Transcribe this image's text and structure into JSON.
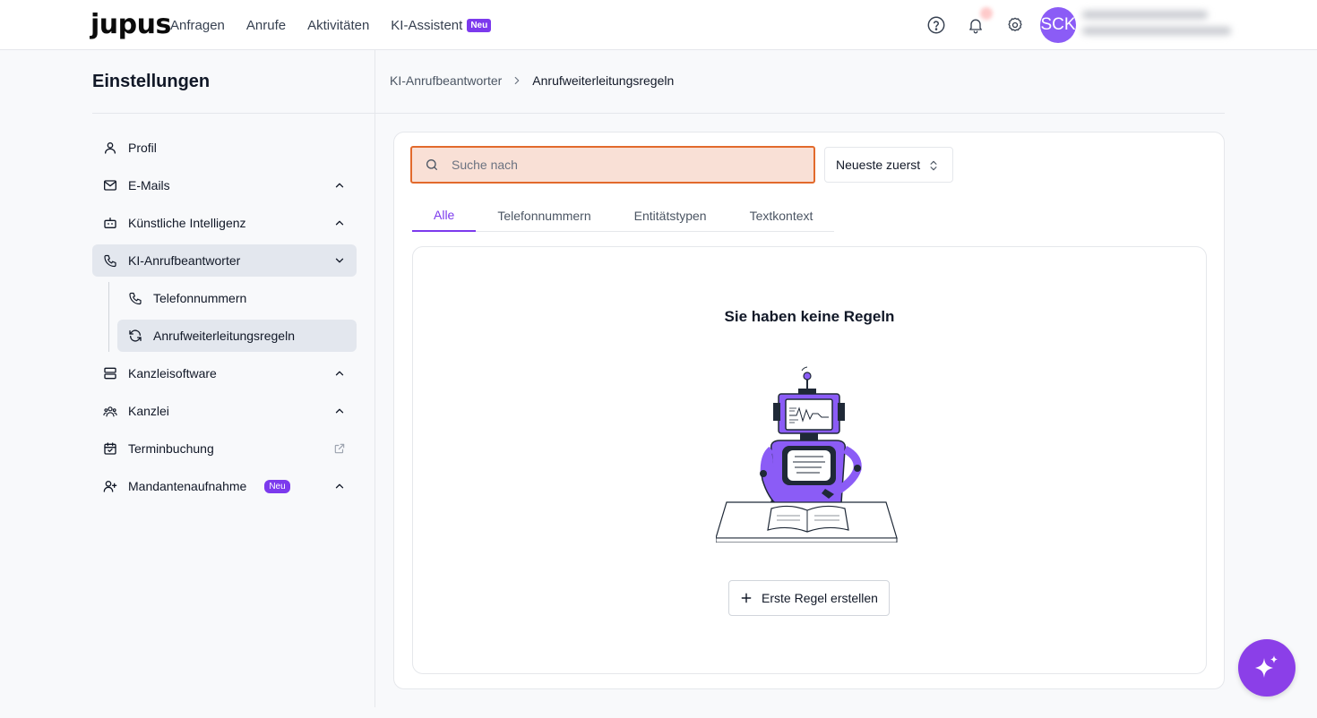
{
  "header": {
    "logo": "jupus",
    "nav": [
      {
        "label": "Anfragen"
      },
      {
        "label": "Anrufe"
      },
      {
        "label": "Aktivitäten"
      },
      {
        "label": "KI-Assistent",
        "badge": "Neu"
      }
    ],
    "avatar_initials": "SCK",
    "icons": [
      "help-icon",
      "bell-icon",
      "gear-icon"
    ]
  },
  "sidebar": {
    "title": "Einstellungen",
    "items": [
      {
        "label": "Profil",
        "icon": "user-icon"
      },
      {
        "label": "E-Mails",
        "icon": "mail-icon",
        "chevron": "up"
      },
      {
        "label": "Künstliche Intelligenz",
        "icon": "robot-icon",
        "chevron": "up"
      },
      {
        "label": "KI-Anrufbeantworter",
        "icon": "phone-icon",
        "chevron": "down",
        "active": true
      },
      {
        "label": "Telefonnummern",
        "icon": "phone-icon"
      },
      {
        "label": "Anrufweiterleitungsregeln",
        "icon": "refresh-icon",
        "active": true
      },
      {
        "label": "Kanzleisoftware",
        "icon": "server-icon",
        "chevron": "up"
      },
      {
        "label": "Kanzlei",
        "icon": "users-icon",
        "chevron": "up"
      },
      {
        "label": "Terminbuchung",
        "icon": "calendar-check-icon",
        "external": true
      },
      {
        "label": "Mandantenaufnahme",
        "icon": "user-plus-icon",
        "badge": "Neu",
        "chevron": "up"
      }
    ]
  },
  "breadcrumb": {
    "parent": "KI-Anrufbeantworter",
    "current": "Anrufweiterleitungsregeln"
  },
  "main": {
    "search": {
      "placeholder": "Suche nach",
      "value": ""
    },
    "sort": {
      "label": "Neueste zuerst"
    },
    "tabs": [
      {
        "label": "Alle",
        "active": true
      },
      {
        "label": "Telefonnummern"
      },
      {
        "label": "Entitätstypen"
      },
      {
        "label": "Textkontext"
      }
    ],
    "empty_state": {
      "title": "Sie haben keine Regeln",
      "button_label": "Erste Regel erstellen"
    }
  },
  "colors": {
    "accent": "#7c3aed",
    "search_border": "#e26a2c",
    "search_bg": "#f9e0d6",
    "fab": "#8b3fe8"
  }
}
